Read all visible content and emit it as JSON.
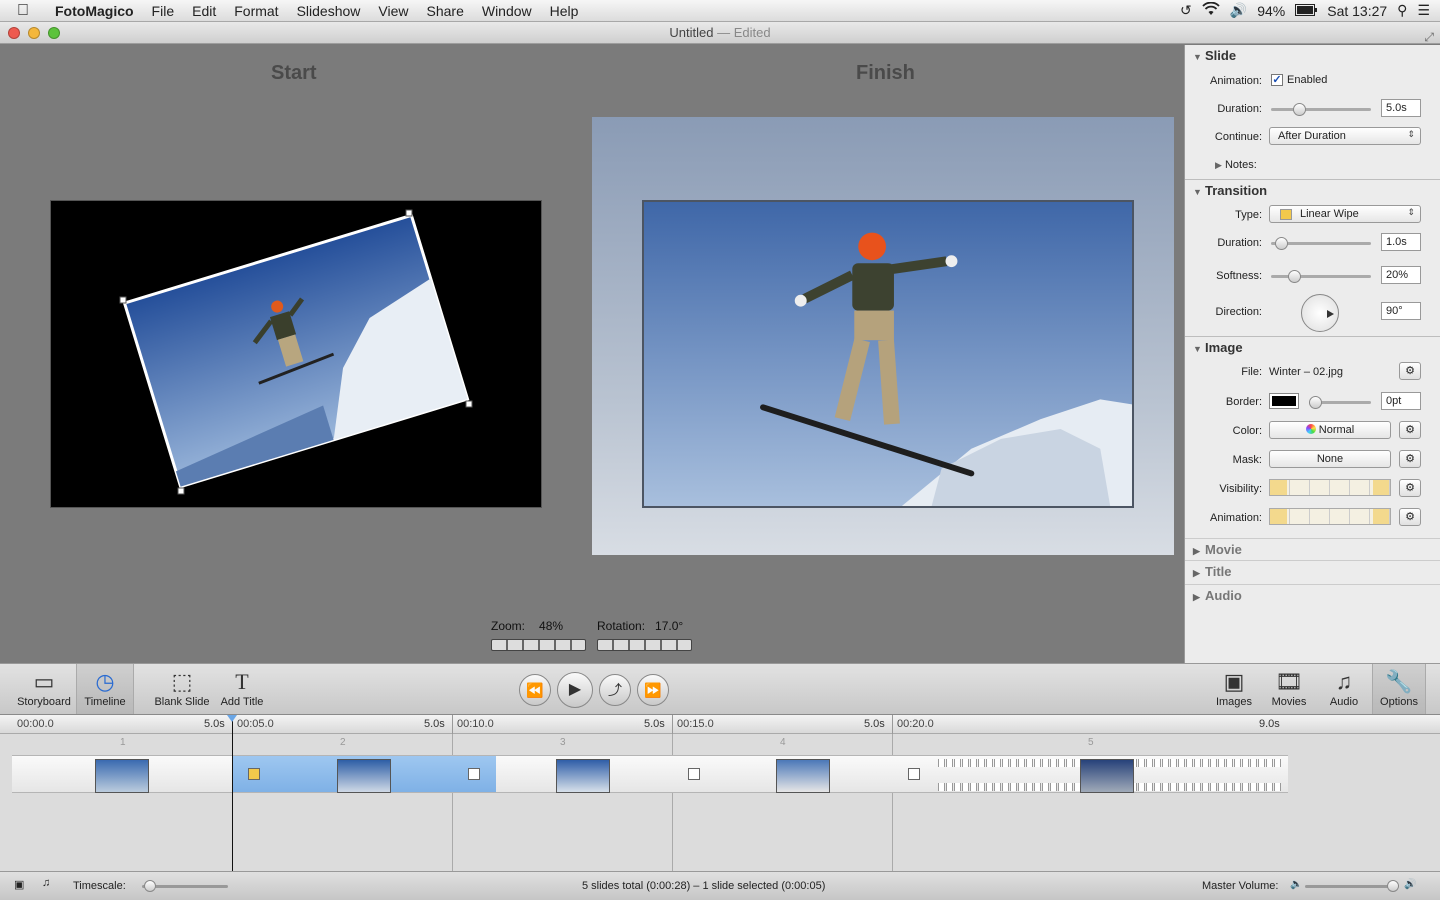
{
  "menubar": {
    "app": "FotoMagico",
    "items": [
      "File",
      "Edit",
      "Format",
      "Slideshow",
      "View",
      "Share",
      "Window",
      "Help"
    ],
    "battery": "94%",
    "clock": "Sat 13:27"
  },
  "window": {
    "title": "Untitled",
    "title_sep": "—",
    "status": "Edited"
  },
  "canvas": {
    "start_label": "Start",
    "finish_label": "Finish",
    "zoom_label": "Zoom:",
    "zoom_value": "48%",
    "rotation_label": "Rotation:",
    "rotation_value": "17.0°"
  },
  "inspector": {
    "slide": {
      "header": "Slide",
      "animation_label": "Animation:",
      "animation_value": "Enabled",
      "duration_label": "Duration:",
      "duration_value": "5.0s",
      "continue_label": "Continue:",
      "continue_value": "After Duration",
      "notes_label": "Notes:"
    },
    "transition": {
      "header": "Transition",
      "type_label": "Type:",
      "type_value": "Linear Wipe",
      "duration_label": "Duration:",
      "duration_value": "1.0s",
      "softness_label": "Softness:",
      "softness_value": "20%",
      "direction_label": "Direction:",
      "direction_value": "90°"
    },
    "image": {
      "header": "Image",
      "file_label": "File:",
      "file_value": "Winter – 02.jpg",
      "border_label": "Border:",
      "border_value": "0pt",
      "color_label": "Color:",
      "color_value": "Normal",
      "mask_label": "Mask:",
      "mask_value": "None",
      "visibility_label": "Visibility:",
      "animation_label": "Animation:"
    },
    "collapsed": [
      "Movie",
      "Title",
      "Audio"
    ]
  },
  "toolbar": {
    "storyboard": "Storyboard",
    "timeline": "Timeline",
    "blank_slide": "Blank Slide",
    "add_title": "Add Title",
    "images": "Images",
    "movies": "Movies",
    "audio": "Audio",
    "options": "Options"
  },
  "timeline": {
    "times": [
      "00:00.0",
      "00:05.0",
      "00:10.0",
      "00:15.0",
      "00:20.0"
    ],
    "durations": [
      "5.0s",
      "5.0s",
      "5.0s",
      "5.0s",
      "9.0s"
    ],
    "slot_numbers": [
      "1",
      "2",
      "3",
      "4",
      "5"
    ]
  },
  "statusbar": {
    "timescale_label": "Timescale:",
    "summary": "5 slides total (0:00:28)  –  1 slide selected (0:00:05)",
    "master_volume_label": "Master Volume:"
  },
  "colors": {
    "accent": "#2a6bd1",
    "selection": "#8fbcec",
    "canvas": "#7b7b7b"
  }
}
